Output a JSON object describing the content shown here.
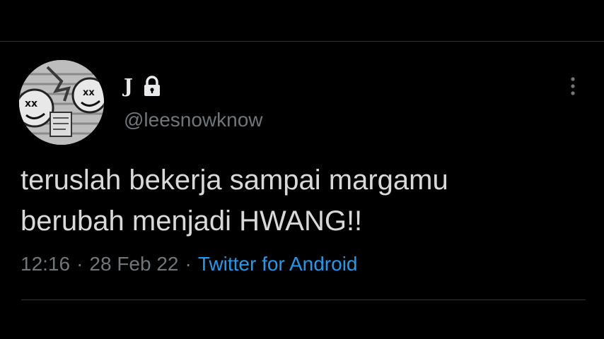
{
  "header": {
    "display_name": "J",
    "handle": "@leesnowknow"
  },
  "icons": {
    "avatar": "profile-avatar",
    "lock": "lock-icon",
    "more": "more-vertical-icon"
  },
  "tweet": {
    "lines": [
      "teruslah bekerja sampai margamu",
      "berubah menjadi HWANG!!"
    ],
    "time": "12:16",
    "separator": "·",
    "date": "28 Feb 22",
    "source": "Twitter for Android"
  },
  "colors": {
    "background": "#000000",
    "primary_text": "#e7e9ea",
    "tweet_text": "#d9d9d9",
    "secondary_text": "#71767b",
    "link": "#1d9bf0",
    "divider": "#2f3336"
  }
}
